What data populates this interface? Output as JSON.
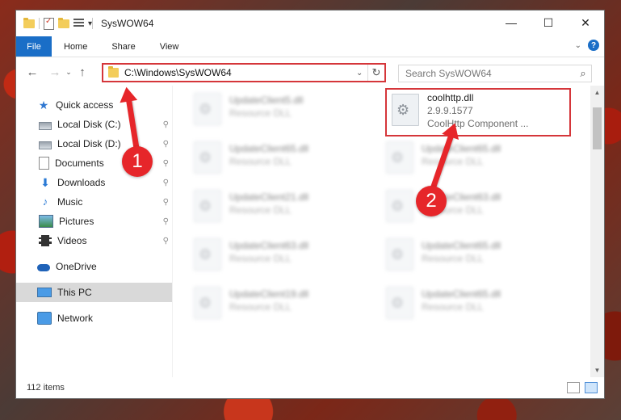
{
  "window": {
    "title": "SysWOW64",
    "controls": {
      "minimize": "—",
      "maximize": "☐",
      "close": "✕"
    }
  },
  "ribbon": {
    "tabs": [
      "File",
      "Home",
      "Share",
      "View"
    ],
    "collapse_glyph": "⌄",
    "help_glyph": "?"
  },
  "navigation": {
    "back": "←",
    "forward": "→",
    "recent": "⌄",
    "up": "↑",
    "address": "C:\\Windows\\SysWOW64",
    "address_dropdown": "⌄",
    "refresh": "↻",
    "search_placeholder": "Search SysWOW64",
    "search_glyph": "⌕"
  },
  "sidebar": {
    "quick_access": "Quick access",
    "items": [
      {
        "label": "Local Disk (C:)",
        "icon": "drive-icon"
      },
      {
        "label": "Local Disk (D:)",
        "icon": "drive-icon"
      },
      {
        "label": "Documents",
        "icon": "documents-icon"
      },
      {
        "label": "Downloads",
        "icon": "downloads-icon"
      },
      {
        "label": "Music",
        "icon": "music-icon"
      },
      {
        "label": "Pictures",
        "icon": "pictures-icon"
      },
      {
        "label": "Videos",
        "icon": "videos-icon"
      }
    ],
    "onedrive": "OneDrive",
    "this_pc": "This PC",
    "network": "Network",
    "pin_glyph": "📌"
  },
  "files": {
    "highlighted": {
      "name": "coolhttp.dll",
      "version": "2.9.9.1577",
      "description": "CoolHttp Component ..."
    },
    "left_column": [
      {
        "name": "UpdateClient5.dll",
        "type": "Resource DLL"
      },
      {
        "name": "UpdateClient65.dll",
        "type": "Resource DLL"
      },
      {
        "name": "UpdateClient21.dll",
        "type": "Resource DLL"
      },
      {
        "name": "UpdateClient63.dll",
        "type": "Resource DLL"
      },
      {
        "name": "UpdateClient19.dll",
        "type": "Resource DLL"
      }
    ],
    "right_column": [
      {
        "name": "UpdateClient65.dll",
        "type": "Resource DLL"
      },
      {
        "name": "UpdateClient63.dll",
        "type": "Resource DLL"
      },
      {
        "name": "UpdateClient65.dll",
        "type": "Resource DLL"
      },
      {
        "name": "UpdateClient65.dll",
        "type": "Resource DLL"
      }
    ]
  },
  "status": {
    "item_count": "112 items"
  },
  "annotations": {
    "step1": "1",
    "step2": "2"
  },
  "colors": {
    "accent": "#1a6ec7",
    "annotation_red": "#e6262a",
    "highlight_border": "#d5363a"
  }
}
